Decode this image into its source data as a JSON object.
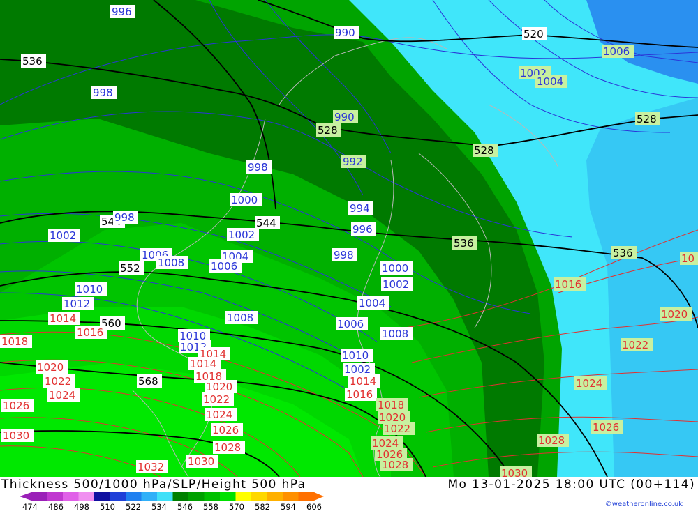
{
  "header": {
    "title": "Thickness 500/1000 hPa/SLP/Height 500 hPa",
    "datetime": "Mo 13-01-2025 18:00 UTC (00+114)",
    "credit": "©weatheronline.co.uk"
  },
  "colors": {
    "slp_isobar_low": "#2a35d8",
    "slp_isobar_high": "#e23030",
    "height_contour": "#000000",
    "label_bg_green": "#c8f0a0",
    "label_bg_white": "#ffffff",
    "background_sea_cyan": "#40e8f8",
    "background_dark_green": "#007a00"
  },
  "scale": {
    "ticks": [
      "474",
      "486",
      "498",
      "510",
      "522",
      "534",
      "546",
      "558",
      "570",
      "582",
      "594",
      "606"
    ],
    "colors": [
      "#9a20b8",
      "#c038d0",
      "#e060e8",
      "#f090f0",
      "#1010a0",
      "#2040d8",
      "#2080f0",
      "#30b0f8",
      "#40e0f8",
      "#008000",
      "#00a000",
      "#00c000",
      "#00e000",
      "#ffff00",
      "#ffd800",
      "#ffb000",
      "#ff9000",
      "#ff7000"
    ]
  },
  "labels": {
    "height": [
      "536",
      "520",
      "528",
      "528",
      "544",
      "544",
      "536",
      "536",
      "552",
      "560",
      "568",
      "528"
    ],
    "slp": [
      "996",
      "990",
      "998",
      "990",
      "998",
      "992",
      "1000",
      "994",
      "998",
      "996",
      "1002",
      "1002",
      "1006",
      "1004",
      "1008",
      "1008",
      "1006",
      "998",
      "1000",
      "1002",
      "1004",
      "1010",
      "1012",
      "1008",
      "1006",
      "1008",
      "1014",
      "1016",
      "1010",
      "1012",
      "1010",
      "1014",
      "1016",
      "1016",
      "1018",
      "1018",
      "1020",
      "1020",
      "1022",
      "1022",
      "1024",
      "1024",
      "1026",
      "1026",
      "1028",
      "1028",
      "1030",
      "1032",
      "1030",
      "1014",
      "1016",
      "1018",
      "1020",
      "1022",
      "1024",
      "1026",
      "1028",
      "1016",
      "1020",
      "1022",
      "1024",
      "1026",
      "1028",
      "1030",
      "1006",
      "1002",
      "1004",
      "10"
    ]
  }
}
